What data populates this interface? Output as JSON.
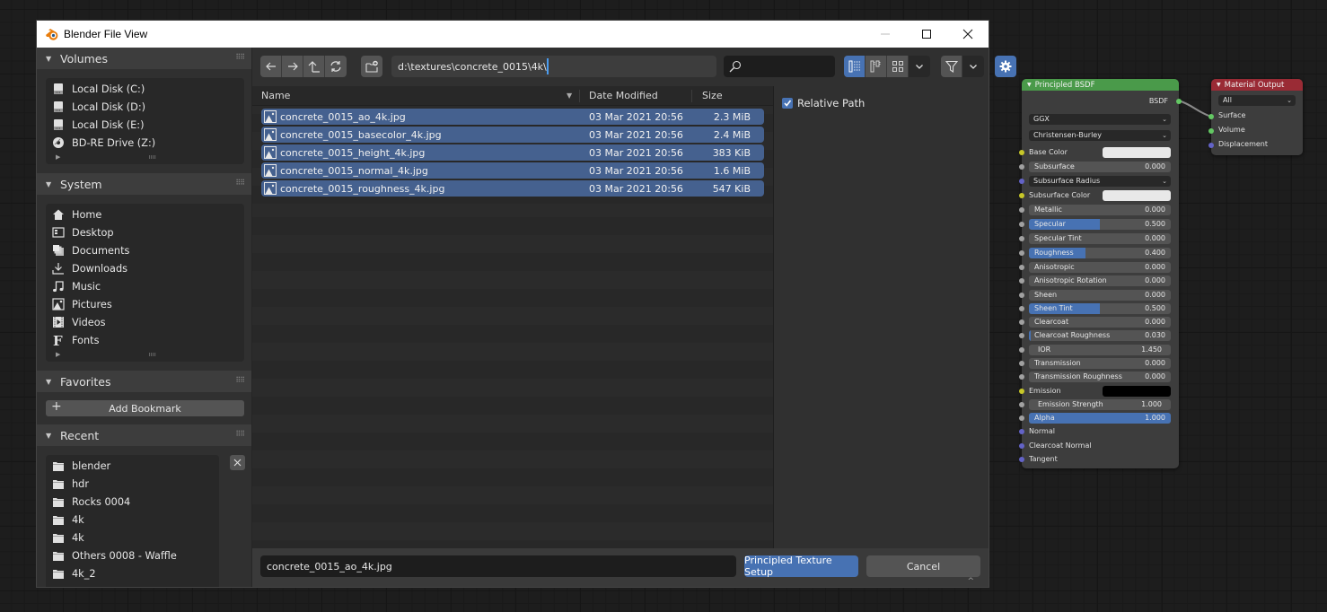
{
  "window": {
    "title": "Blender File View",
    "controls": {
      "minimize": "minimize",
      "maximize": "maximize",
      "close": "close"
    }
  },
  "sidebar": {
    "volumes": {
      "label": "Volumes",
      "items": [
        {
          "label": "Local Disk (C:)",
          "icon": "disk-icon"
        },
        {
          "label": "Local Disk (D:)",
          "icon": "disk-icon"
        },
        {
          "label": "Local Disk (E:)",
          "icon": "disk-icon"
        },
        {
          "label": "BD-RE Drive (Z:)",
          "icon": "disc-icon"
        }
      ]
    },
    "system": {
      "label": "System",
      "items": [
        {
          "label": "Home",
          "icon": "home-icon"
        },
        {
          "label": "Desktop",
          "icon": "desktop-icon"
        },
        {
          "label": "Documents",
          "icon": "documents-icon"
        },
        {
          "label": "Downloads",
          "icon": "download-icon"
        },
        {
          "label": "Music",
          "icon": "music-icon"
        },
        {
          "label": "Pictures",
          "icon": "picture-icon"
        },
        {
          "label": "Videos",
          "icon": "video-icon"
        },
        {
          "label": "Fonts",
          "icon": "font-icon"
        }
      ]
    },
    "favorites": {
      "label": "Favorites",
      "add_bookmark": "Add Bookmark"
    },
    "recent": {
      "label": "Recent",
      "items": [
        {
          "label": "blender",
          "icon": "folder-icon"
        },
        {
          "label": "hdr",
          "icon": "folder-icon"
        },
        {
          "label": "Rocks 0004",
          "icon": "folder-icon"
        },
        {
          "label": "4k",
          "icon": "folder-icon"
        },
        {
          "label": "4k",
          "icon": "folder-icon"
        },
        {
          "label": "Others 0008 - Waffle",
          "icon": "folder-icon"
        },
        {
          "label": "4k_2",
          "icon": "folder-icon"
        }
      ]
    }
  },
  "toolbar": {
    "path": "d:\\textures\\concrete_0015\\4k\\",
    "search_placeholder": "",
    "display_mode": "vertical-list",
    "settings_active": true
  },
  "filelist": {
    "columns": {
      "name": "Name",
      "date": "Date Modified",
      "size": "Size"
    },
    "files": [
      {
        "name": "concrete_0015_ao_4k.jpg",
        "date": "03 Mar 2021 20:56",
        "size": "2.3 MiB",
        "selected": true
      },
      {
        "name": "concrete_0015_basecolor_4k.jpg",
        "date": "03 Mar 2021 20:56",
        "size": "2.4 MiB",
        "selected": true
      },
      {
        "name": "concrete_0015_height_4k.jpg",
        "date": "03 Mar 2021 20:56",
        "size": "383 KiB",
        "selected": true
      },
      {
        "name": "concrete_0015_normal_4k.jpg",
        "date": "03 Mar 2021 20:56",
        "size": "1.6 MiB",
        "selected": true
      },
      {
        "name": "concrete_0015_roughness_4k.jpg",
        "date": "03 Mar 2021 20:56",
        "size": "547 KiB",
        "selected": true
      }
    ]
  },
  "options": {
    "relative_path": {
      "label": "Relative Path",
      "checked": true
    }
  },
  "bottombar": {
    "filename": "concrete_0015_ao_4k.jpg",
    "execute_label": "Principled Texture Setup",
    "cancel_label": "Cancel"
  },
  "nodes": {
    "principled": {
      "title": "Principled BSDF",
      "header_color": "#4a9a4a",
      "output": "BSDF",
      "distribution": "GGX",
      "subsurface_method": "Christensen-Burley",
      "inputs": [
        {
          "label": "Base Color",
          "type": "color",
          "color": "#e8e8e8",
          "socket": "yellow"
        },
        {
          "label": "Subsurface",
          "type": "slider",
          "value": "0.000",
          "fill": 0,
          "socket": "gray"
        },
        {
          "label": "Subsurface Radius",
          "type": "dropdown",
          "socket": "blue"
        },
        {
          "label": "Subsurface Color",
          "type": "color",
          "color": "#e8e8e8",
          "socket": "yellow"
        },
        {
          "label": "Metallic",
          "type": "slider",
          "value": "0.000",
          "fill": 0,
          "socket": "gray"
        },
        {
          "label": "Specular",
          "type": "slider",
          "value": "0.500",
          "fill": 0.5,
          "socket": "gray"
        },
        {
          "label": "Specular Tint",
          "type": "slider",
          "value": "0.000",
          "fill": 0,
          "socket": "gray"
        },
        {
          "label": "Roughness",
          "type": "slider",
          "value": "0.400",
          "fill": 0.4,
          "socket": "gray"
        },
        {
          "label": "Anisotropic",
          "type": "slider",
          "value": "0.000",
          "fill": 0,
          "socket": "gray"
        },
        {
          "label": "Anisotropic Rotation",
          "type": "slider",
          "value": "0.000",
          "fill": 0,
          "socket": "gray"
        },
        {
          "label": "Sheen",
          "type": "slider",
          "value": "0.000",
          "fill": 0,
          "socket": "gray"
        },
        {
          "label": "Sheen Tint",
          "type": "slider",
          "value": "0.500",
          "fill": 0.5,
          "socket": "gray"
        },
        {
          "label": "Clearcoat",
          "type": "slider",
          "value": "0.000",
          "fill": 0,
          "socket": "gray"
        },
        {
          "label": "Clearcoat Roughness",
          "type": "slider",
          "value": "0.030",
          "fill": 0.03,
          "socket": "gray"
        },
        {
          "label": "IOR",
          "type": "number",
          "value": "1.450",
          "socket": "gray"
        },
        {
          "label": "Transmission",
          "type": "slider",
          "value": "0.000",
          "fill": 0,
          "socket": "gray"
        },
        {
          "label": "Transmission Roughness",
          "type": "slider",
          "value": "0.000",
          "fill": 0,
          "socket": "gray"
        },
        {
          "label": "Emission",
          "type": "color",
          "color": "#000000",
          "socket": "yellow"
        },
        {
          "label": "Emission Strength",
          "type": "number",
          "value": "1.000",
          "socket": "gray"
        },
        {
          "label": "Alpha",
          "type": "slider",
          "value": "1.000",
          "fill": 1,
          "socket": "gray"
        },
        {
          "label": "Normal",
          "type": "socket",
          "socket": "blue"
        },
        {
          "label": "Clearcoat Normal",
          "type": "socket",
          "socket": "blue"
        },
        {
          "label": "Tangent",
          "type": "socket",
          "socket": "blue"
        }
      ]
    },
    "output": {
      "title": "Material Output",
      "header_color": "#9a2b35",
      "target": "All",
      "inputs": [
        {
          "label": "Surface",
          "socket": "green"
        },
        {
          "label": "Volume",
          "socket": "green"
        },
        {
          "label": "Displacement",
          "socket": "blue"
        }
      ]
    }
  },
  "colors": {
    "accent": "#4772b3",
    "selected_row": "#45618f",
    "window_bg": "#303030"
  }
}
